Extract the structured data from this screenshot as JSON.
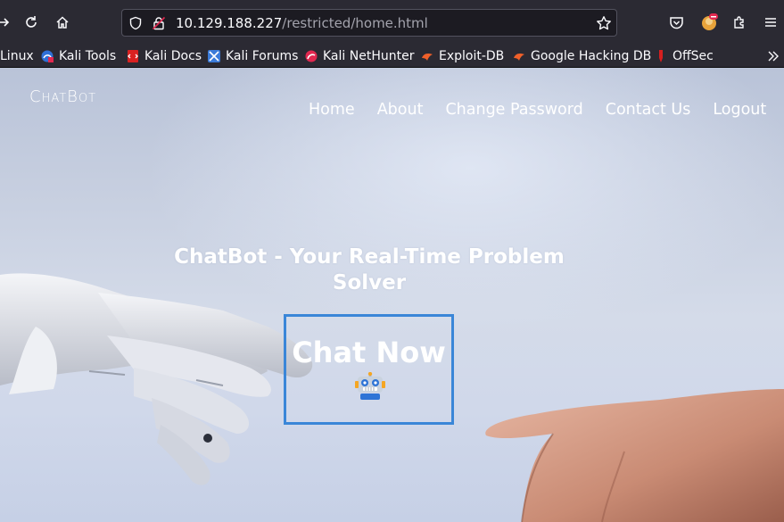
{
  "browser": {
    "url_host": "10.129.188.227",
    "url_path": "/restricted/home.html",
    "bookmarks": [
      {
        "label": "Linux",
        "icon": "none"
      },
      {
        "label": "Kali Tools",
        "icon": "kali-tools-icon"
      },
      {
        "label": "Kali Docs",
        "icon": "kali-docs-icon"
      },
      {
        "label": "Kali Forums",
        "icon": "kali-forums-icon"
      },
      {
        "label": "Kali NetHunter",
        "icon": "nethunter-icon"
      },
      {
        "label": "Exploit-DB",
        "icon": "exploit-db-icon"
      },
      {
        "label": "Google Hacking DB",
        "icon": "ghdb-icon"
      },
      {
        "label": "OffSec",
        "icon": "offsec-icon"
      }
    ]
  },
  "site": {
    "logo": "ChatBot",
    "nav": [
      "Home",
      "About",
      "Change Password",
      "Contact Us",
      "Logout"
    ],
    "hero_title": "ChatBot - Your Real-Time Problem Solver",
    "cta_label": "Chat Now",
    "cta_icon": "robot-icon"
  },
  "colors": {
    "accent_border": "#3a86d8",
    "chrome_bg": "#2b2a33"
  }
}
